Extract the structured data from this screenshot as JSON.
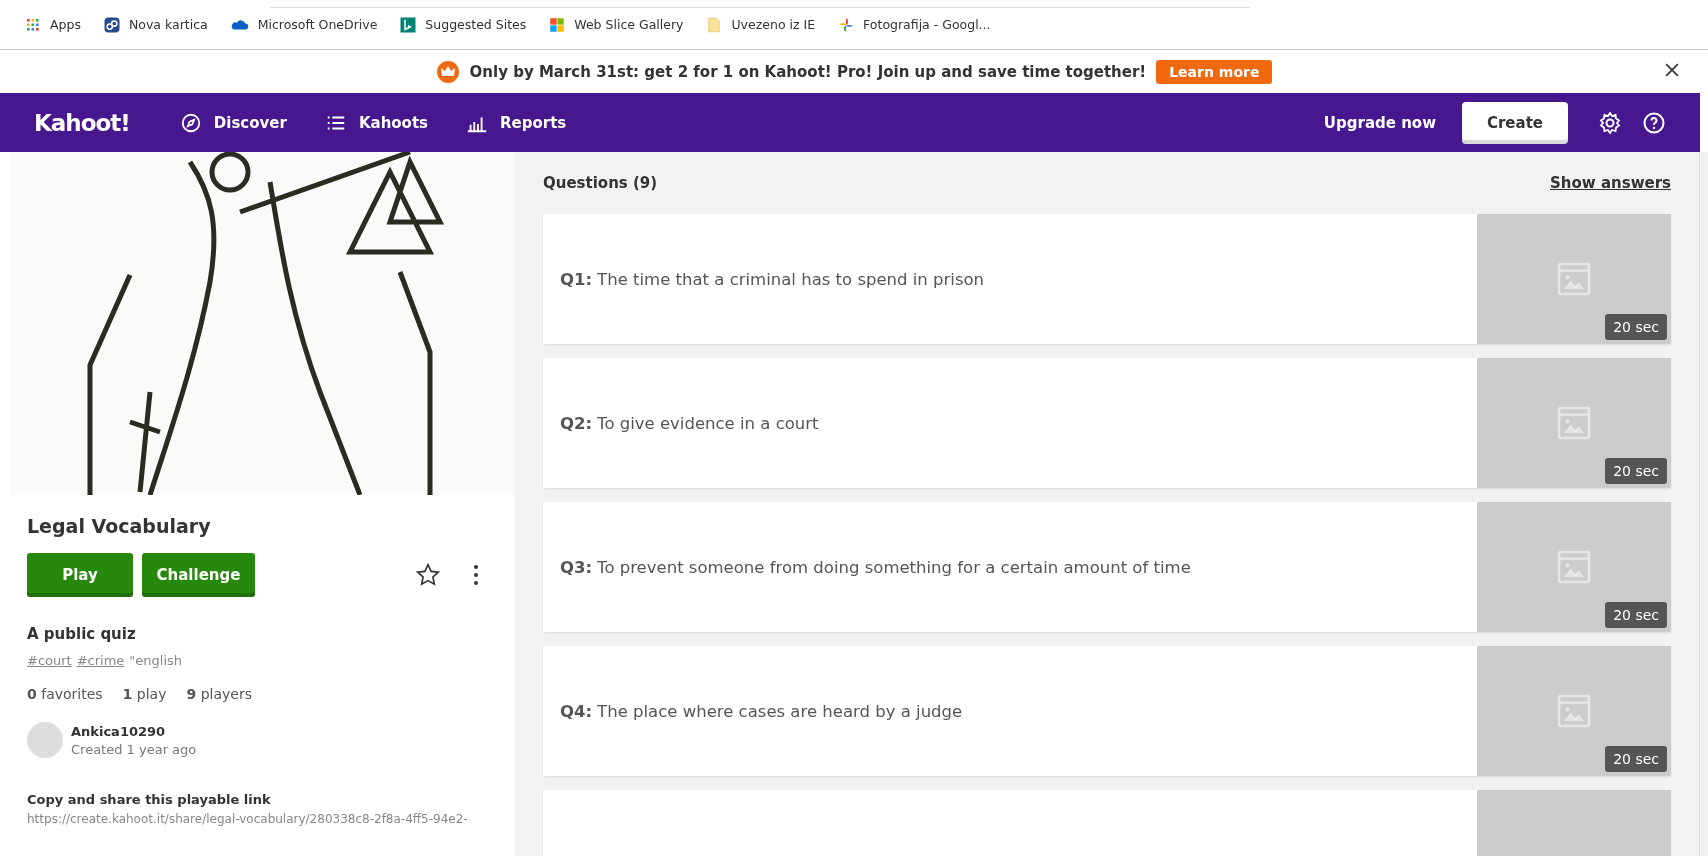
{
  "bookmarks": [
    {
      "label": "Apps",
      "kind": "apps"
    },
    {
      "label": "Nova kartica",
      "kind": "link"
    },
    {
      "label": "Microsoft OneDrive",
      "kind": "cloud"
    },
    {
      "label": "Suggested Sites",
      "kind": "bing"
    },
    {
      "label": "Web Slice Gallery",
      "kind": "windows"
    },
    {
      "label": "Uvezeno iz IE",
      "kind": "folder"
    },
    {
      "label": "Fotografija - Googl...",
      "kind": "pinwheel"
    }
  ],
  "banner": {
    "text": "Only by March 31st: get 2 for 1 on Kahoot! Pro! Join up and save time together!",
    "button": "Learn more"
  },
  "nav": {
    "logo": "Kahoot!",
    "items": [
      {
        "label": "Discover",
        "kind": "compass"
      },
      {
        "label": "Kahoots",
        "kind": "list"
      },
      {
        "label": "Reports",
        "kind": "bars"
      }
    ],
    "upgrade": "Upgrade now",
    "create": "Create"
  },
  "quiz": {
    "title": "Legal Vocabulary",
    "buttons": [
      "Play",
      "Challenge"
    ],
    "favorite": false,
    "visibility": "A public quiz",
    "tags": [
      {
        "label": "#court",
        "kind": "link"
      },
      {
        "label": "#crime",
        "kind": "link"
      },
      {
        "label": "\"english",
        "kind": "text"
      }
    ],
    "stats": [
      "**0** favorites",
      "**1** play",
      "**9** players"
    ],
    "author": "Ankica10290",
    "created": "Created 1 year ago",
    "share_title": "Copy and share this playable link",
    "share_link": "https://create.kahoot.it/share/legal-vocabulary/280338c8-2f8a-4ff5-94e2-"
  },
  "questions": {
    "title": "Questions (9)",
    "show_answers": "Show answers",
    "items": [
      {
        "number": "Q1:",
        "text": "The time that a criminal has to spend in prison",
        "time": "20 sec"
      },
      {
        "number": "Q2:",
        "text": "To give evidence in a court",
        "time": "20 sec"
      },
      {
        "number": "Q3:",
        "text": "To prevent someone from doing something for a certain amount of time",
        "time": "20 sec"
      },
      {
        "number": "Q4:",
        "text": "The place where cases are heard by a judge",
        "time": "20 sec"
      }
    ]
  }
}
